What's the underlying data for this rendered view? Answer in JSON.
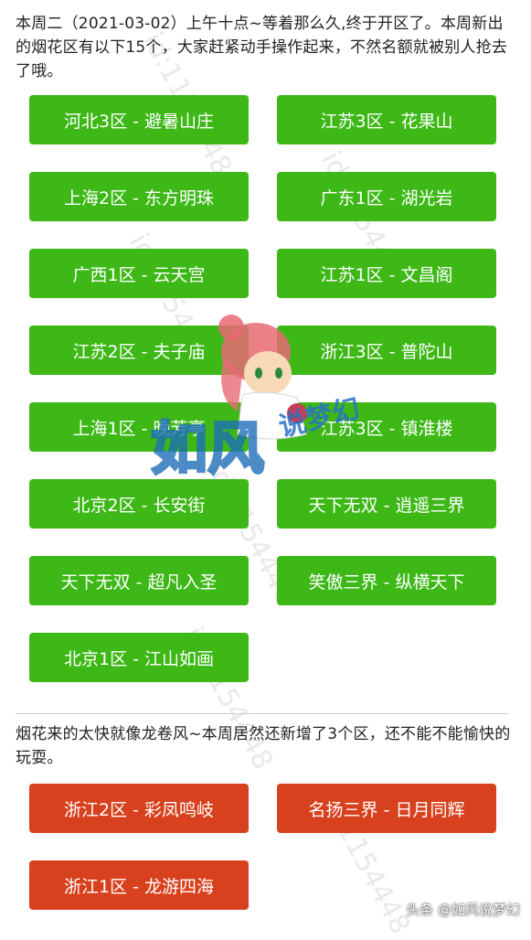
{
  "intro": "本周二（2021-03-02）上午十点~等着那么久,终于开区了。本周新出的烟花区有以下15个，大家赶紧动手操作起来，不然名额就被别人抢去了哦。",
  "green_servers": [
    "河北3区 - 避暑山庄",
    "江苏3区 - 花果山",
    "上海2区 - 东方明珠",
    "广东1区 - 湖光岩",
    "广西1区 - 云天宫",
    "江苏1区 - 文昌阁",
    "江苏2区 - 夫子庙",
    "浙江3区 - 普陀山",
    "上海1区 - 晚芳亭",
    "江苏3区 - 镇淮楼",
    "北京2区 - 长安街",
    "天下无双 - 逍遥三界",
    "天下无双 - 超凡入圣",
    "笑傲三界 - 纵横天下",
    "北京1区 - 江山如画"
  ],
  "note": "烟花来的太快就像龙卷风~本周居然还新增了3个区，还不能不能愉快的玩耍。",
  "red_servers": [
    "浙江2区 - 彩凤鸣岐",
    "名扬三界 - 日月同辉",
    "浙江1区 - 龙游四海"
  ],
  "watermark": {
    "id_text": "id:1154448",
    "logo_text": "如风",
    "logo_sub": "说梦幻"
  },
  "credit": "头条 @如风说梦幻",
  "colors": {
    "green_button": "#3db817",
    "red_button": "#d8411e",
    "text": "#222222",
    "divider": "#cfcfcf"
  }
}
